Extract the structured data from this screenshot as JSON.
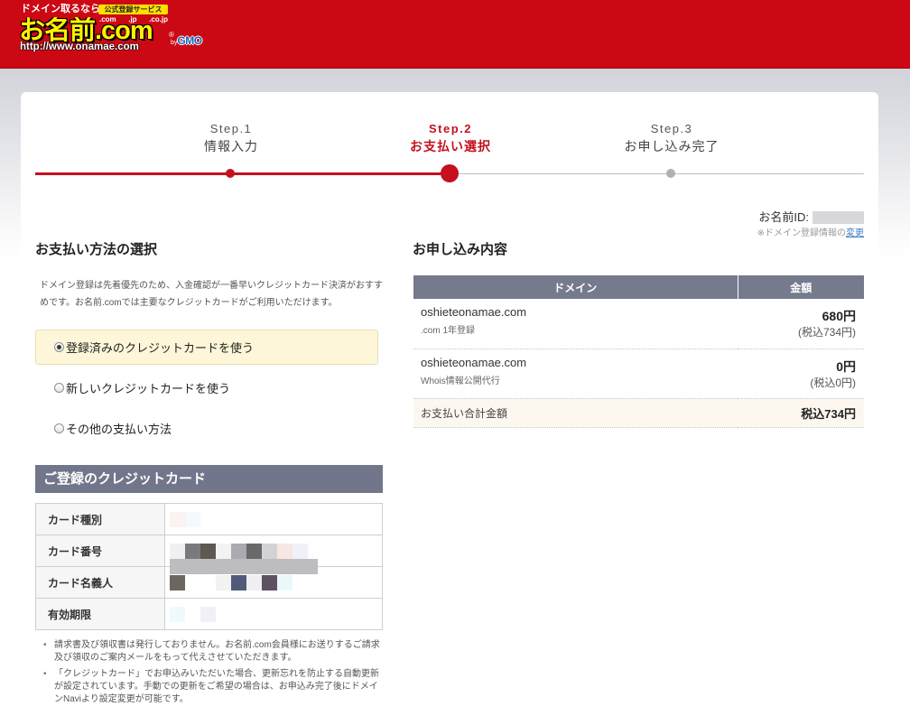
{
  "colors": {
    "brand_red": "#cc0814",
    "step_active": "#c4101f",
    "step_inactive": "#b0b0b0",
    "table_header": "#767a8d",
    "selected_option_bg": "#fdf6d8",
    "total_row_bg": "#fdf8ef",
    "link": "#3a7ec6",
    "logo_yellow": "#fff200"
  },
  "header": {
    "logo": {
      "tagline": "ドメイン取るなら",
      "badge": "公式登録サービス",
      "tlds": [
        ".com",
        ".jp",
        ".co.jp"
      ],
      "name": "お名前.com",
      "registered": "®",
      "url": "http://www.onamae.com",
      "by": "by",
      "gmo": "GMO"
    }
  },
  "progress": {
    "current_step": 2,
    "steps": [
      {
        "step": "Step.1",
        "label": "情報入力"
      },
      {
        "step": "Step.2",
        "label": "お支払い選択"
      },
      {
        "step": "Step.3",
        "label": "お申し込み完了"
      }
    ]
  },
  "account": {
    "id_label": "お名前ID:",
    "note": "※ドメイン登録情報の",
    "note_link": "変更"
  },
  "payment": {
    "title": "お支払い方法の選択",
    "description": "ドメイン登録は先着優先のため、入金確認が一番早いクレジットカード決済がおすすめです。お名前.comでは主要なクレジットカードがご利用いただけます。",
    "options": [
      {
        "label": "登録済みのクレジットカードを使う",
        "selected": true
      },
      {
        "label": "新しいクレジットカードを使う",
        "selected": false
      },
      {
        "label": "その他の支払い方法",
        "selected": false
      }
    ]
  },
  "card": {
    "title": "ご登録のクレジットカード",
    "rows": [
      "カード種別",
      "カード番号",
      "カード名義人",
      "有効期限"
    ]
  },
  "notes": [
    "請求書及び領収書は発行しておりません。お名前.com会員様にお送りするご請求及び領収のご案内メールをもって代えさせていただきます。",
    "「クレジットカード」でお申込みいただいた場合、更新忘れを防止する自動更新が設定されています。手動での更新をご希望の場合は、お申込み完了後にドメインNaviより設定変更が可能です。"
  ],
  "order": {
    "title": "お申し込み内容",
    "columns": [
      "ドメイン",
      "金額"
    ],
    "items": [
      {
        "domain": "oshieteonamae.com",
        "detail": ".com 1年登録",
        "price": "680円",
        "tax_price": "(税込734円)"
      },
      {
        "domain": "oshieteonamae.com",
        "detail": "Whois情報公開代行",
        "price": "0円",
        "tax_price": "(税込0円)"
      }
    ],
    "total_label": "お支払い合計金額",
    "total": "税込734円"
  }
}
